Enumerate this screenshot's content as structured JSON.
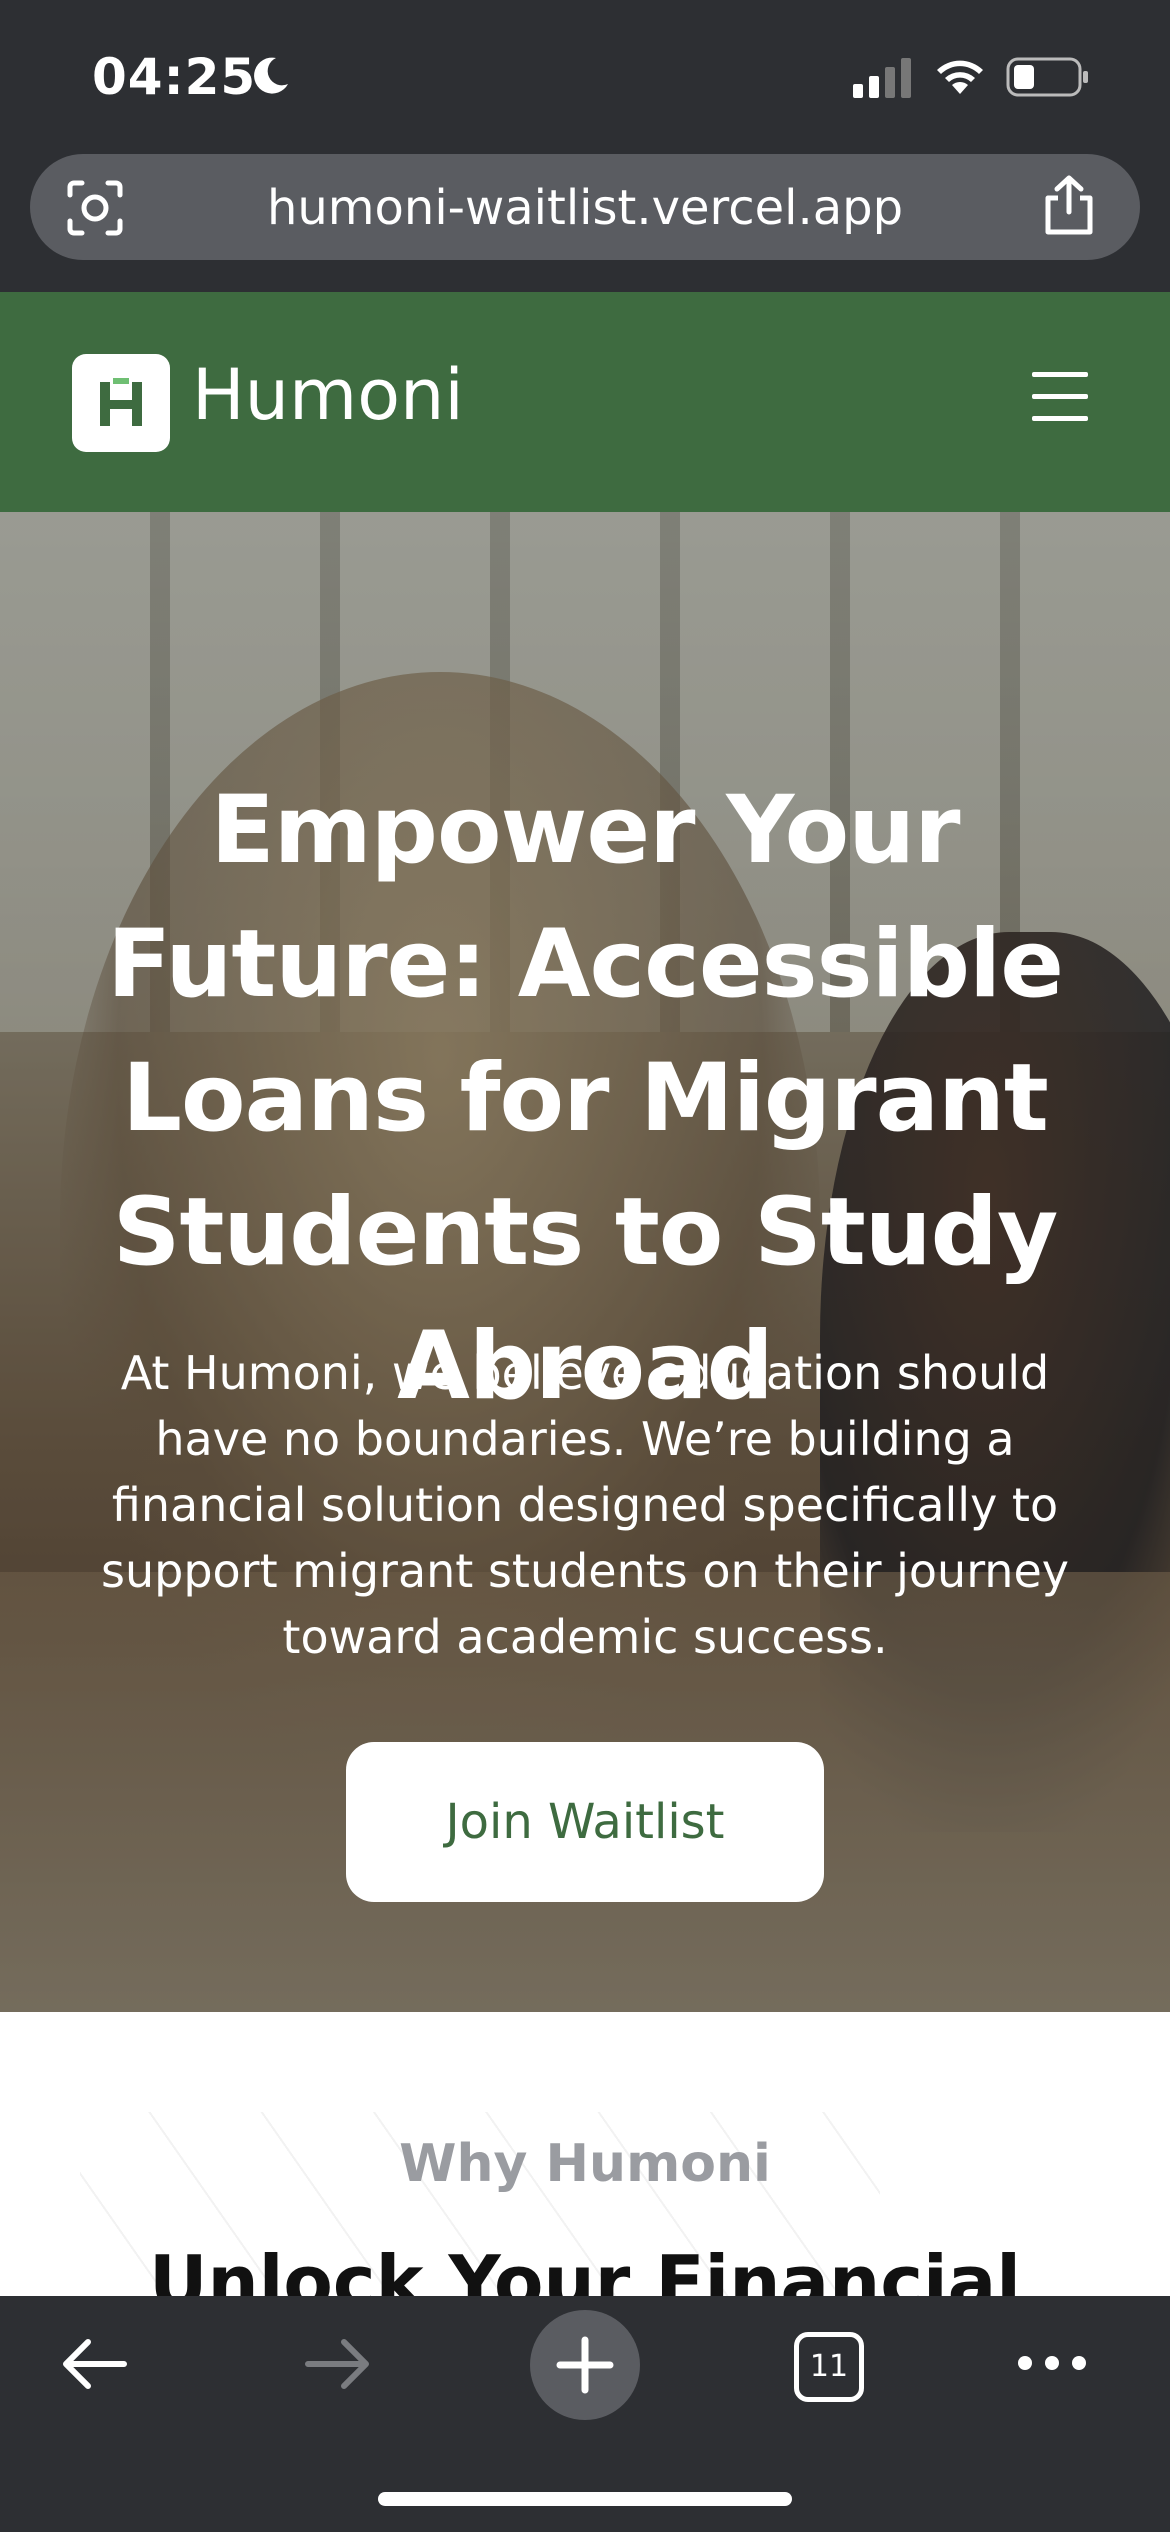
{
  "status_bar": {
    "time": "04:25",
    "icons": [
      "moon-icon",
      "cellular-signal-icon",
      "wifi-icon",
      "battery-icon"
    ]
  },
  "browser": {
    "url": "humoni-waitlist.vercel.app",
    "icons": [
      "lens-icon",
      "share-icon"
    ]
  },
  "site_header": {
    "logo_text": "Humoni",
    "brand_color": "#3e6b40",
    "menu_icon": "hamburger-menu-icon"
  },
  "hero": {
    "title": "Empower Your Future: Accessible Loans for Migrant Students to Study Abroad",
    "subtitle": "At Humoni, we believe education should have no boundaries. We’re building a financial solution designed specifically to support migrant students on their journey toward academic success.",
    "cta_label": "Join Waitlist"
  },
  "section": {
    "eyebrow": "Why Humoni",
    "title": "Unlock Your Financial"
  },
  "toolbar": {
    "tab_count": "11",
    "icons": [
      "back-arrow-icon",
      "forward-arrow-icon",
      "new-tab-plus-icon",
      "tabs-icon",
      "more-dots-icon"
    ]
  }
}
